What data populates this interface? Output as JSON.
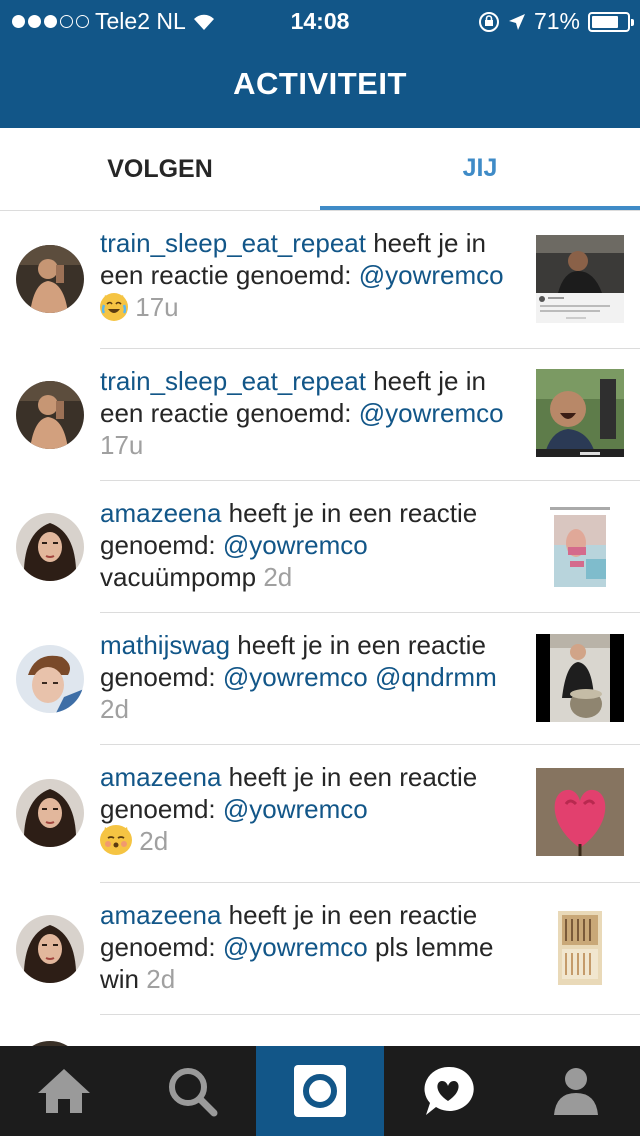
{
  "status_bar": {
    "carrier": "Tele2 NL",
    "time": "14:08",
    "battery_pct": "71%",
    "signal_bars_filled": 3,
    "signal_bars_total": 5
  },
  "header": {
    "title": "ACTIVITEIT"
  },
  "tabs": [
    {
      "label": "VOLGEN",
      "active": false
    },
    {
      "label": "JIJ",
      "active": true
    }
  ],
  "activity": [
    {
      "user": "train_sleep_eat_repeat",
      "text": " heeft je in een reactie genoemd: ",
      "mention": "@yowremco",
      "suffix": "",
      "emoji": "laughing-crying-cat-emoji",
      "time": "17u"
    },
    {
      "user": "train_sleep_eat_repeat",
      "text": " heeft je in een reactie genoemd: ",
      "mention": "@yowremco",
      "suffix": "",
      "emoji": "",
      "time": "17u"
    },
    {
      "user": "amazeena",
      "text": " heeft je in een reactie genoemd: ",
      "mention": "@yowremco",
      "suffix": " vacuümpomp",
      "emoji": "",
      "time": "2d"
    },
    {
      "user": "mathijswag",
      "text": " heeft je in een reactie genoemd: ",
      "mention": "@yowremco",
      "suffix": " @qndrmm",
      "emoji": "",
      "time": "2d"
    },
    {
      "user": "amazeena",
      "text": " heeft je in een reactie genoemd: ",
      "mention": "@yowremco",
      "suffix": "",
      "emoji": "kissing-cat-emoji",
      "time": "2d"
    },
    {
      "user": "amazeena",
      "text": " heeft je in een reactie genoemd: ",
      "mention": "@yowremco",
      "suffix": " pls lemme win",
      "emoji": "",
      "time": "2d"
    }
  ],
  "tab_bar": {
    "items": [
      "home-icon",
      "search-icon",
      "camera-icon",
      "activity-heart-icon",
      "profile-icon"
    ],
    "active": "camera-icon"
  },
  "colors": {
    "brand_blue": "#125688",
    "link_blue": "#3f8bc7",
    "timestamp_gray": "#a0a0a0",
    "tabbar_bg": "#1c1c1c"
  }
}
